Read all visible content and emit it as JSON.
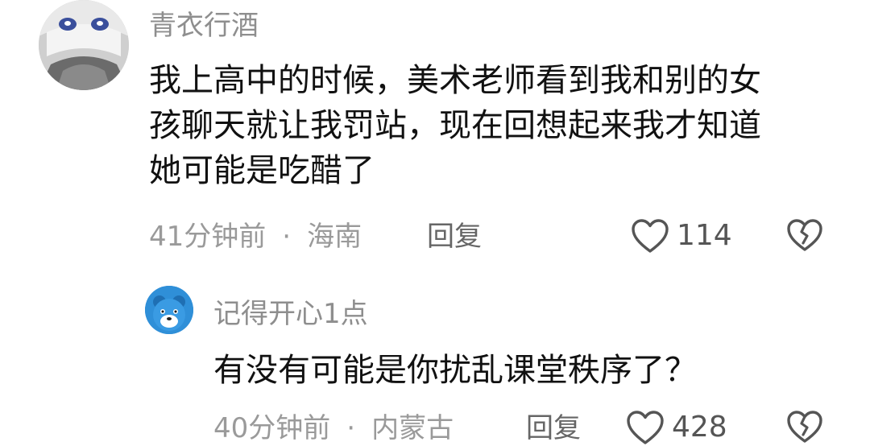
{
  "comments": [
    {
      "username": "青衣行酒",
      "lines": [
        "我上高中的时候，美术老师看到我和别的女",
        "孩聊天就让我罚站，现在回想起来我才知道",
        "她可能是吃醋了"
      ],
      "time": "41分钟前",
      "separator": "·",
      "location": "海南",
      "reply_label": "回复",
      "likes": "114"
    },
    {
      "username": "记得开心1点",
      "lines": [
        "有没有可能是你扰乱课堂秩序了？"
      ],
      "time": "40分钟前",
      "separator": "·",
      "location": "内蒙古",
      "reply_label": "回复",
      "likes": "428"
    }
  ],
  "icons": {
    "like": "heart-outline-icon",
    "dislike": "broken-heart-icon"
  },
  "colors": {
    "username": "#8e8e8e",
    "body": "#111111",
    "meta": "#9a9a9a"
  }
}
